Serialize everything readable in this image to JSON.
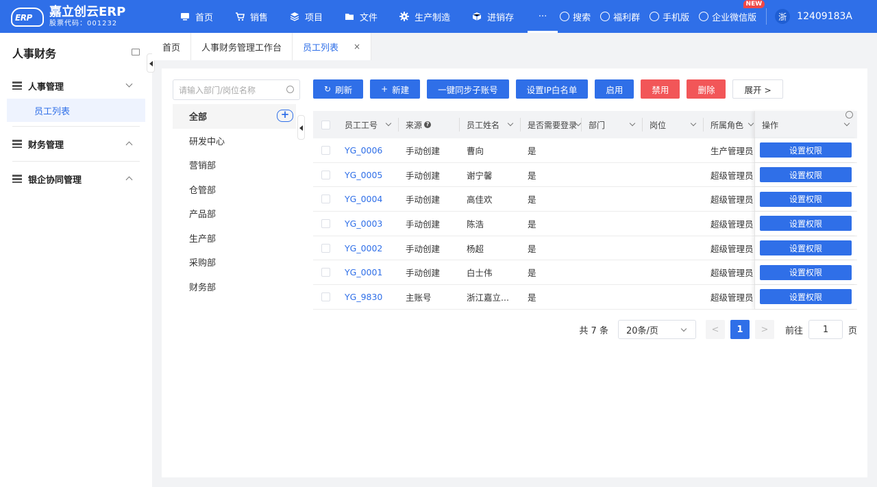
{
  "brand": {
    "name": "嘉立创云ERP",
    "sub": "股票代码：001232",
    "mark": "ERP"
  },
  "nav": [
    {
      "label": "首页",
      "icon": "home-icon"
    },
    {
      "label": "销售",
      "icon": "cart-icon"
    },
    {
      "label": "项目",
      "icon": "layers-icon"
    },
    {
      "label": "文件",
      "icon": "folder-icon"
    },
    {
      "label": "生产制造",
      "icon": "gear-icon"
    },
    {
      "label": "进销存",
      "icon": "box-icon"
    },
    {
      "label": "···",
      "icon": "more-icon"
    }
  ],
  "tools": {
    "search": "搜索",
    "welfare": "福利群",
    "mobile": "手机版",
    "wechat": "企业微信版",
    "new_badge": "NEW"
  },
  "user": {
    "avatar": "浙",
    "name": "12409183A"
  },
  "sidebar": {
    "title": "人事财务",
    "groups": [
      {
        "label": "人事管理",
        "expanded": true,
        "items": [
          {
            "label": "员工列表"
          }
        ]
      },
      {
        "label": "财务管理",
        "expanded": false
      },
      {
        "label": "银企协同管理",
        "expanded": false
      }
    ]
  },
  "tabs": [
    {
      "label": "首页"
    },
    {
      "label": "人事财务管理工作台"
    },
    {
      "label": "员工列表",
      "close": "×"
    }
  ],
  "search": {
    "placeholder": "请输入部门/岗位名称"
  },
  "departments": [
    "全部",
    "研发中心",
    "营销部",
    "仓管部",
    "产品部",
    "生产部",
    "采购部",
    "财务部"
  ],
  "add_symbol": "+",
  "toolbar": {
    "refresh": "刷新",
    "refresh_icon": "↻",
    "new": "新建",
    "new_icon": "+",
    "sync": "一键同步子账号",
    "ip": "设置IP白名单",
    "enable": "启用",
    "disable": "禁用",
    "delete": "删除",
    "expand": "展开 >"
  },
  "table": {
    "headers": {
      "id": "员工工号",
      "source": "来源",
      "source_help": "?",
      "name": "员工姓名",
      "login": "是否需要登录",
      "dept": "部门",
      "post": "岗位",
      "role": "所属角色",
      "op": "操作"
    },
    "rows": [
      {
        "id": "YG_0006",
        "source": "手动创建",
        "name": "曹向",
        "login": "是",
        "dept": "",
        "post": "",
        "role": "生产管理员",
        "op": "设置权限"
      },
      {
        "id": "YG_0005",
        "source": "手动创建",
        "name": "谢宁馨",
        "login": "是",
        "dept": "",
        "post": "",
        "role": "超级管理员",
        "op": "设置权限"
      },
      {
        "id": "YG_0004",
        "source": "手动创建",
        "name": "高佳欢",
        "login": "是",
        "dept": "",
        "post": "",
        "role": "超级管理员",
        "op": "设置权限"
      },
      {
        "id": "YG_0003",
        "source": "手动创建",
        "name": "陈浩",
        "login": "是",
        "dept": "",
        "post": "",
        "role": "超级管理员",
        "op": "设置权限"
      },
      {
        "id": "YG_0002",
        "source": "手动创建",
        "name": "杨超",
        "login": "是",
        "dept": "",
        "post": "",
        "role": "超级管理员",
        "op": "设置权限"
      },
      {
        "id": "YG_0001",
        "source": "手动创建",
        "name": "白士伟",
        "login": "是",
        "dept": "",
        "post": "",
        "role": "超级管理员",
        "op": "设置权限"
      },
      {
        "id": "YG_9830",
        "source": "主账号",
        "name": "浙江嘉立...",
        "login": "是",
        "dept": "",
        "post": "",
        "role": "超级管理员",
        "op": "设置权限"
      }
    ]
  },
  "pager": {
    "total": "共 7 条",
    "page_size": "20条/页",
    "prev": "<",
    "current": "1",
    "next": ">",
    "goto_label": "前往",
    "goto_value": "1",
    "page_suffix": "页"
  }
}
